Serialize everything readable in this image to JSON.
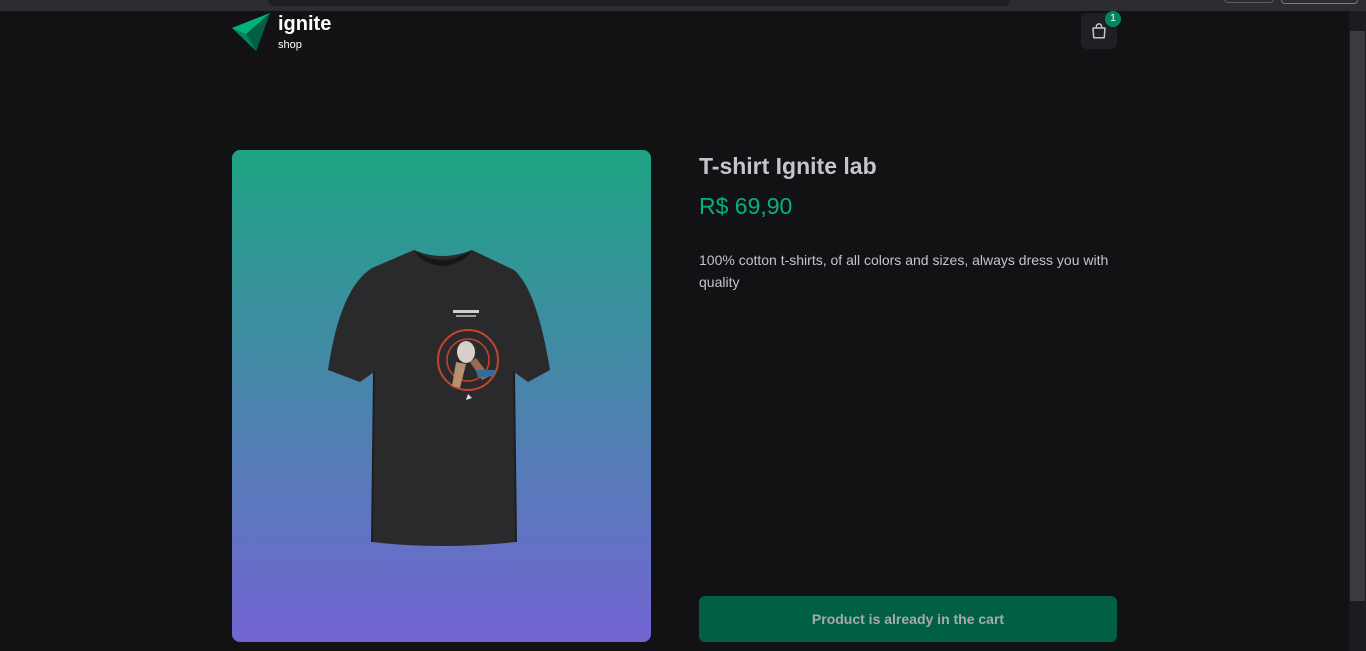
{
  "header": {
    "brand": "ignite",
    "brand_sub": "shop",
    "cart_count": "1",
    "cart_icon": "shopping-bag-icon"
  },
  "product": {
    "title": "T-shirt Ignite lab",
    "price": "R$ 69,90",
    "description": "100% cotton t-shirts, of all colors and sizes, always dress you with quality",
    "button_label": "Product is already in the cart",
    "image": "black-tshirt-astronaut-print"
  },
  "colors": {
    "background": "#121214",
    "accent_green": "#00b37e",
    "button_bg": "#015f43",
    "gradient_top": "#1ea483",
    "gradient_bottom": "#7465d4"
  }
}
